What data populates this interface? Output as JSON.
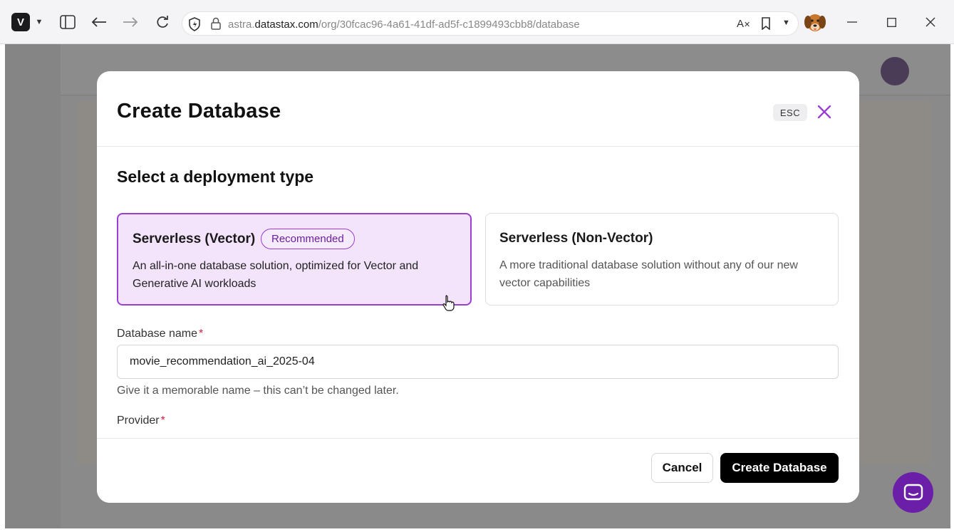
{
  "browser": {
    "url_host": "astra.datastax.com",
    "url_host_prefix": "astra.",
    "url_host_main": "datastax.com",
    "url_path": "/org/30fcac96-4a61-41df-ad5f-c1899493cbb8/database"
  },
  "modal": {
    "title": "Create Database",
    "esc_label": "ESC",
    "section_title": "Select a deployment type",
    "deployment_options": [
      {
        "title": "Serverless (Vector)",
        "badge": "Recommended",
        "description": "An all-in-one database solution, optimized for Vector and Generative AI workloads",
        "selected": true
      },
      {
        "title": "Serverless (Non-Vector)",
        "description": "A more traditional database solution without any of our new vector capabilities",
        "selected": false
      }
    ],
    "database_name": {
      "label": "Database name",
      "required_mark": "*",
      "value": "movie_recommendation_ai_2025-04",
      "help": "Give it a memorable name – this can’t be changed later."
    },
    "provider": {
      "label": "Provider",
      "required_mark": "*"
    },
    "footer": {
      "cancel_label": "Cancel",
      "create_label": "Create Database"
    }
  },
  "colors": {
    "accent": "#9a3fd2",
    "selected_bg": "#f3e4fb",
    "chat_fab": "#6b1fa8"
  }
}
